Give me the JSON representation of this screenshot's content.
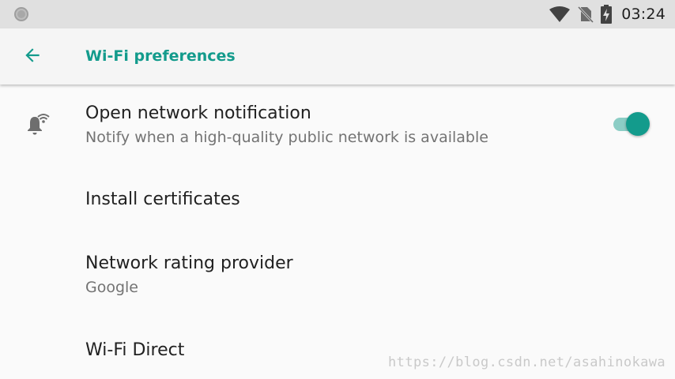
{
  "status_bar": {
    "time": "03:24",
    "icons": [
      "notification-dot-icon",
      "wifi-signal-icon",
      "no-sim-icon",
      "battery-charging-icon"
    ]
  },
  "app_bar": {
    "back_icon": "arrow-back-icon",
    "title": "Wi-Fi preferences"
  },
  "preferences": [
    {
      "title": "Open network notification",
      "summary": "Notify when a high-quality public network is available",
      "icon": "wifi-notification-bell-icon",
      "toggle_on": true
    },
    {
      "title": "Install certificates"
    },
    {
      "title": "Network rating provider",
      "summary": "Google"
    },
    {
      "title": "Wi-Fi Direct"
    }
  ],
  "watermark": "https://blog.csdn.net/asahinokawa",
  "colors": {
    "accent": "#139b8c",
    "toggle_track": "#8ccdc5",
    "status_bar": "#e0e0e0",
    "background": "#fafafa"
  }
}
